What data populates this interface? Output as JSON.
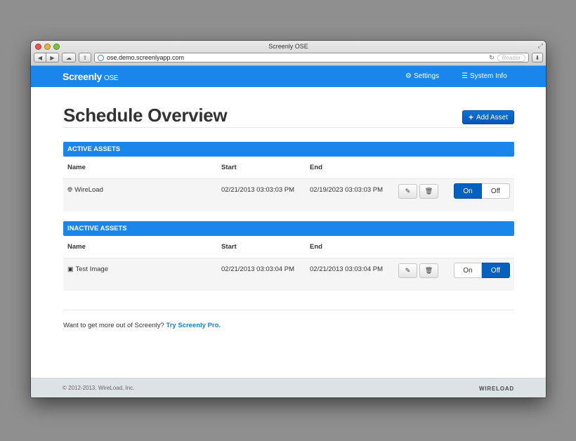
{
  "browser": {
    "window_title": "Screenly OSE",
    "url": "ose.demo.screenlyapp.com",
    "reader_label": "Reader"
  },
  "navbar": {
    "brand": "Screenly",
    "brand_sub": "OSE",
    "settings_label": "Settings",
    "sysinfo_label": "System Info"
  },
  "page": {
    "title": "Schedule Overview",
    "add_asset_label": "Add Asset"
  },
  "columns": {
    "name": "Name",
    "start": "Start",
    "end": "End"
  },
  "active": {
    "header": "ACTIVE ASSETS",
    "rows": [
      {
        "name": "WireLoad",
        "start": "02/21/2013 03:03:03 PM",
        "end": "02/19/2023 03:03:03 PM",
        "icon": "globe-icon",
        "state": "On"
      }
    ]
  },
  "inactive": {
    "header": "INACTIVE ASSETS",
    "rows": [
      {
        "name": "Test Image",
        "start": "02/21/2013 03:03:04 PM",
        "end": "02/21/2013 03:03:04 PM",
        "icon": "image-icon",
        "state": "Off"
      }
    ]
  },
  "toggle": {
    "on": "On",
    "off": "Off"
  },
  "promo": {
    "text": "Want to get more out of Screenly?",
    "link": "Try Screenly Pro."
  },
  "footer": {
    "copyright": "© 2012-2013. WireLoad, Inc.",
    "logo": "WIRELOAD"
  },
  "colors": {
    "accent": "#1a86ec",
    "button_active": "#0560bf"
  }
}
